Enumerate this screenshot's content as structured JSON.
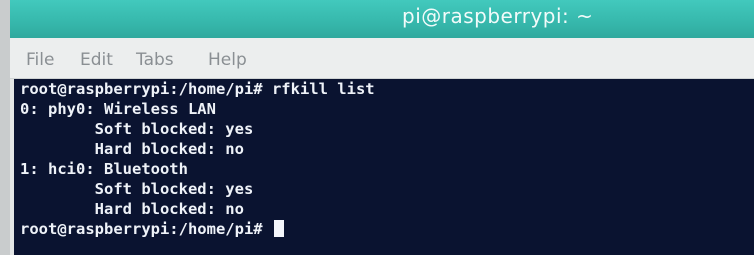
{
  "window": {
    "title": "pi@raspberrypi: ~"
  },
  "menu": {
    "file": "File",
    "edit": "Edit",
    "tabs": "Tabs",
    "help": "Help"
  },
  "terminal": {
    "lines": [
      "root@raspberrypi:/home/pi# rfkill list",
      "0: phy0: Wireless LAN",
      "        Soft blocked: yes",
      "        Hard blocked: no",
      "1: hci0: Bluetooth",
      "        Soft blocked: yes",
      "        Hard blocked: no"
    ],
    "prompt": "root@raspberrypi:/home/pi# "
  }
}
